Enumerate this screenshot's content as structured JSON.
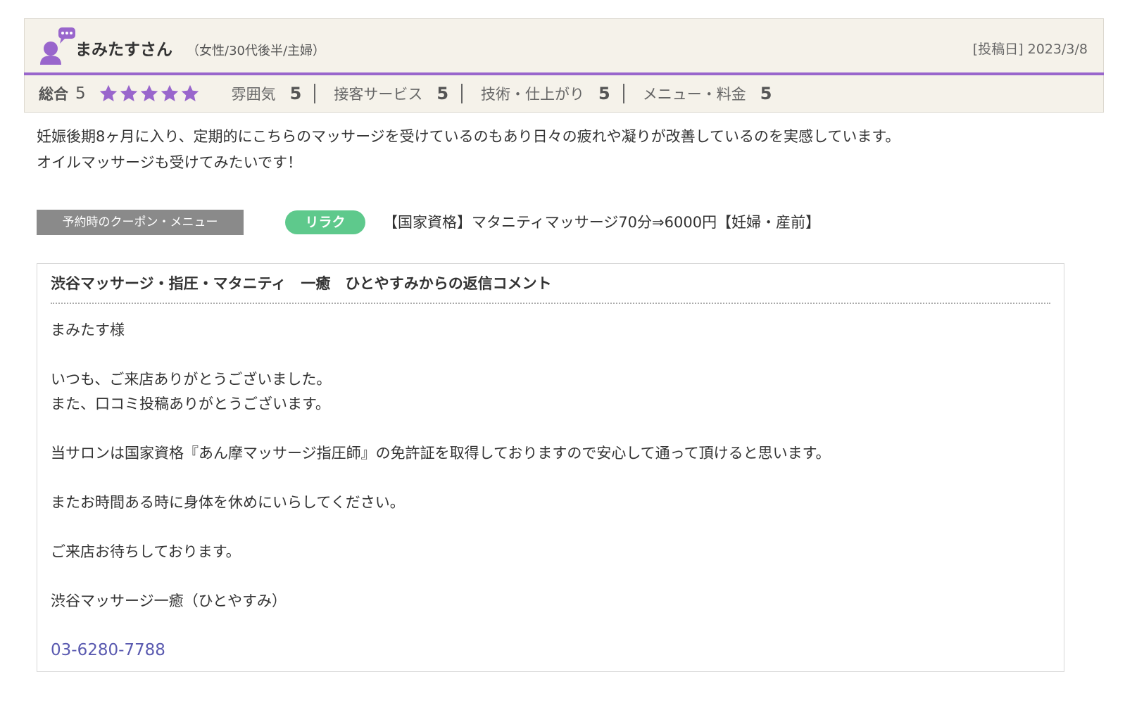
{
  "colors": {
    "accent_purple": "#9966cc",
    "header_bg": "#f5f2ea",
    "badge_green": "#5ec98c",
    "tag_gray": "#8a8a8a",
    "phone_link": "#5a5ab0"
  },
  "reviewer": {
    "name": "まみたすさん",
    "meta": "（女性/30代後半/主婦）",
    "post_date": "[投稿日] 2023/3/8",
    "avatar_icon": "user-speech-bubble-icon"
  },
  "rating": {
    "overall_label": "総合",
    "overall_score": "5",
    "stars": 5,
    "criteria": [
      {
        "label": "雰囲気",
        "score": "5"
      },
      {
        "label": "接客サービス",
        "score": "5"
      },
      {
        "label": "技術・仕上がり",
        "score": "5"
      },
      {
        "label": "メニュー・料金",
        "score": "5"
      }
    ]
  },
  "review": {
    "lines": [
      "妊娠後期8ヶ月に入り、定期的にこちらのマッサージを受けているのもあり日々の疲れや凝りが改善しているのを実感しています。",
      "オイルマッサージも受けてみたいです！"
    ]
  },
  "coupon": {
    "tag": "予約時のクーポン・メニュー",
    "badge": "リラク",
    "name": "【国家資格】マタニティマッサージ70分⇒6000円【妊婦・産前】"
  },
  "reply": {
    "title": "渋谷マッサージ・指圧・マタニティ　一癒　ひとやすみからの返信コメント",
    "greeting": "まみたす様",
    "para1": [
      "いつも、ご来店ありがとうございました。",
      "また、口コミ投稿ありがとうございます。"
    ],
    "para2": "当サロンは国家資格『あん摩マッサージ指圧師』の免許証を取得しておりますので安心して通って頂けると思います。",
    "para3": "またお時間ある時に身体を休めにいらしてください。",
    "para4": "ご来店お待ちしております。",
    "signature": "渋谷マッサージ一癒（ひとやすみ）",
    "phone": "03-6280-7788"
  }
}
